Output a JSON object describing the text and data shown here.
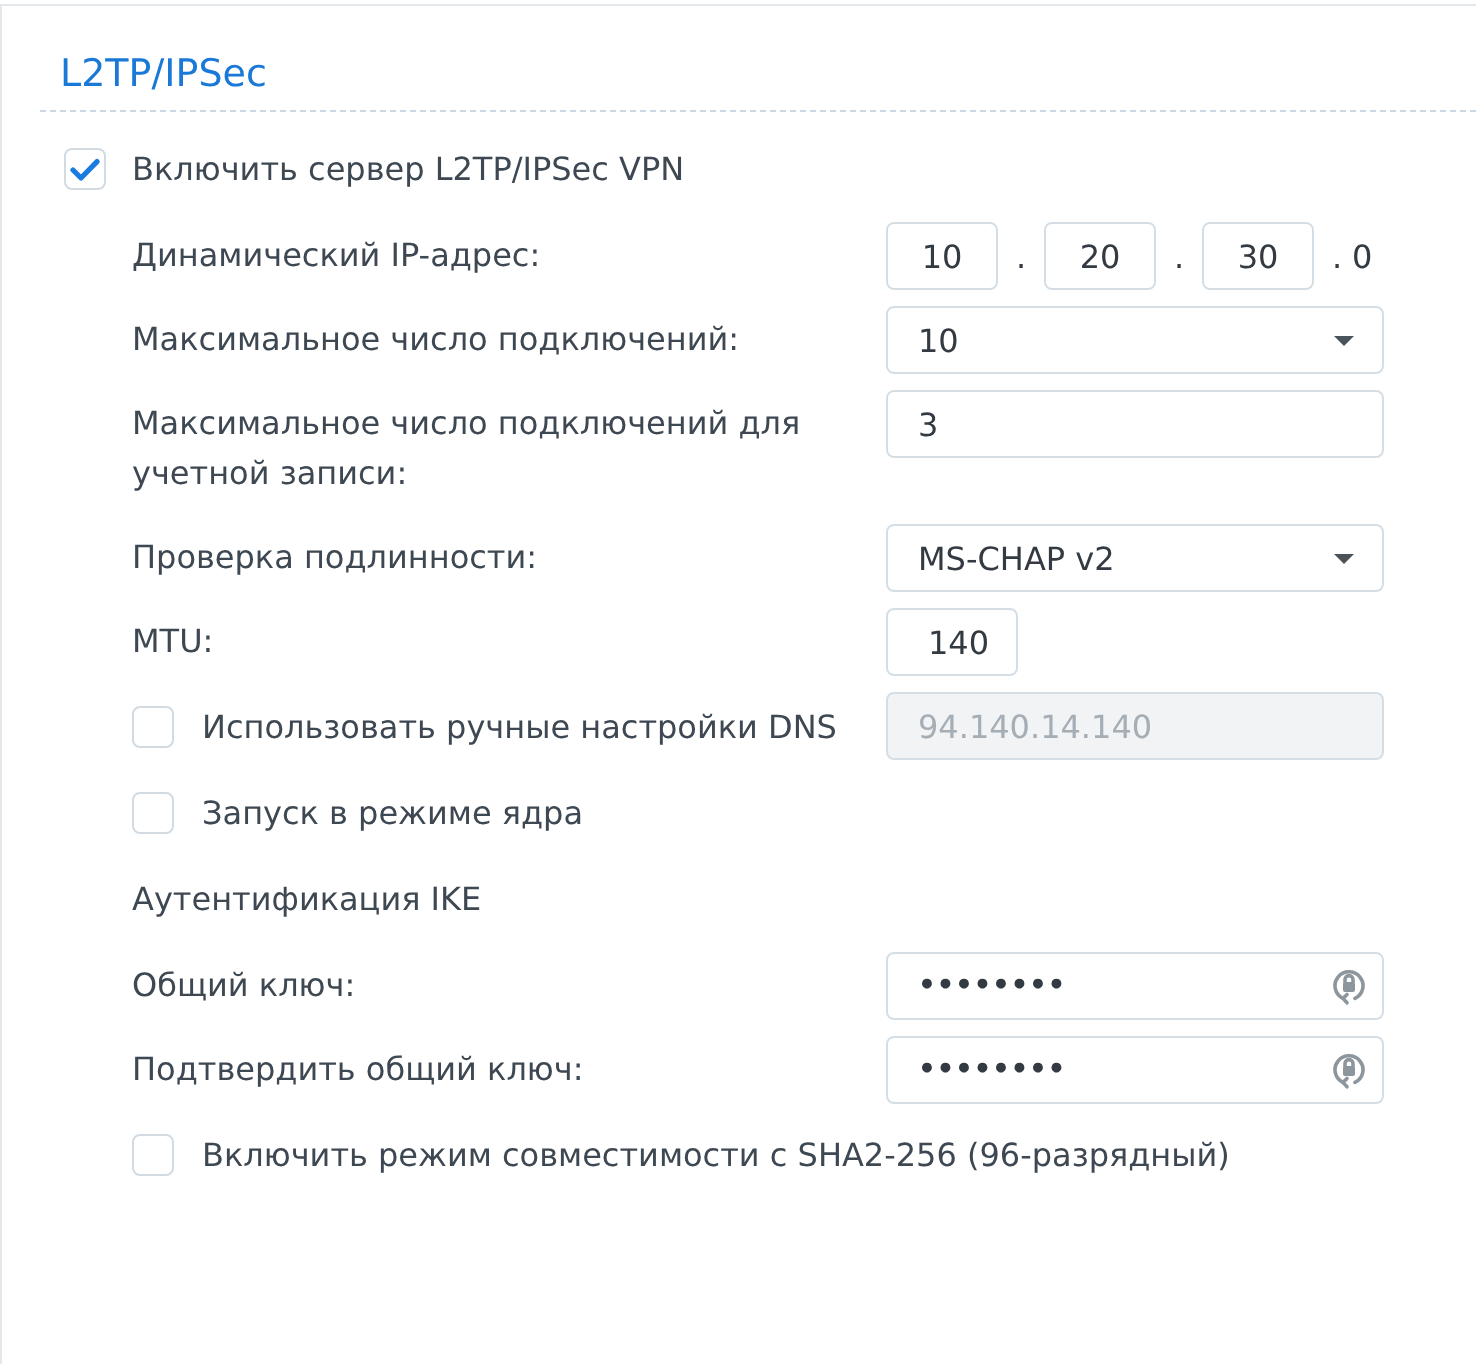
{
  "section": {
    "title": "L2TP/IPSec"
  },
  "enable": {
    "label": "Включить сервер L2TP/IPSec VPN",
    "checked": true
  },
  "rows": [
    {
      "kind": "ip",
      "label": "Динамический IP-адрес:",
      "octets": [
        {
          "value": "10",
          "separator": "."
        },
        {
          "value": "20",
          "separator": "."
        },
        {
          "value": "30",
          "separator": "."
        }
      ],
      "last": "0"
    },
    {
      "kind": "select",
      "label": "Максимальное число подключений:",
      "value": "10"
    },
    {
      "kind": "input",
      "label": "Максимальное число подключений для учетной записи:",
      "value": "3"
    },
    {
      "kind": "select",
      "label": "Проверка подлинности:",
      "value": "MS-CHAP v2"
    },
    {
      "kind": "narrow-input",
      "label": "MTU:",
      "value": "140"
    },
    {
      "kind": "checkbox",
      "label": "Использовать ручные настройки DNS",
      "checked": false,
      "field": {
        "value": "94.140.14.140",
        "disabled": true
      }
    },
    {
      "kind": "checkbox",
      "label": "Запуск в режиме ядра",
      "checked": false
    },
    {
      "kind": "heading",
      "label": "Аутентификация IKE"
    },
    {
      "kind": "password",
      "label": "Общий ключ:",
      "value": "••••••••"
    },
    {
      "kind": "password",
      "label": "Подтвердить общий ключ:",
      "value": "••••••••"
    },
    {
      "kind": "checkbox",
      "label": "Включить режим совместимости с SHA2-256 (96-разрядный)",
      "checked": false
    }
  ]
}
